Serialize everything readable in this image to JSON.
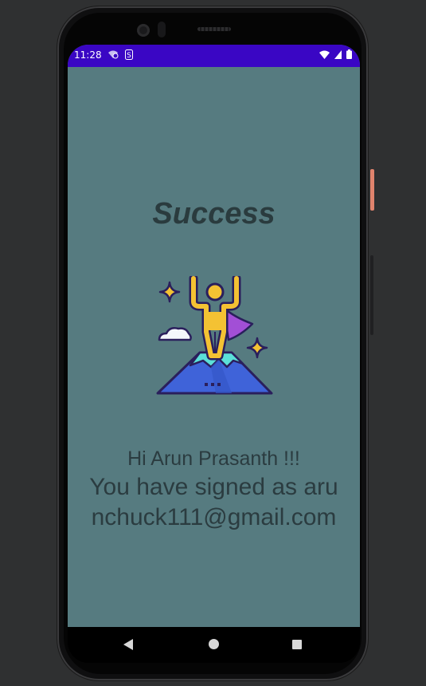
{
  "status_bar": {
    "time": "11:28",
    "background": "#3a06c4"
  },
  "screen": {
    "background": "#567b80",
    "title": "Success",
    "greeting": "Hi Arun Prasanth !!!",
    "signed_as": "You have signed as arunchuck111@gmail.com"
  },
  "nav": {
    "back_icon": "back-triangle-icon",
    "home_icon": "home-circle-icon",
    "recents_icon": "recents-square-icon"
  },
  "illustration": "hero-on-mountain-icon"
}
